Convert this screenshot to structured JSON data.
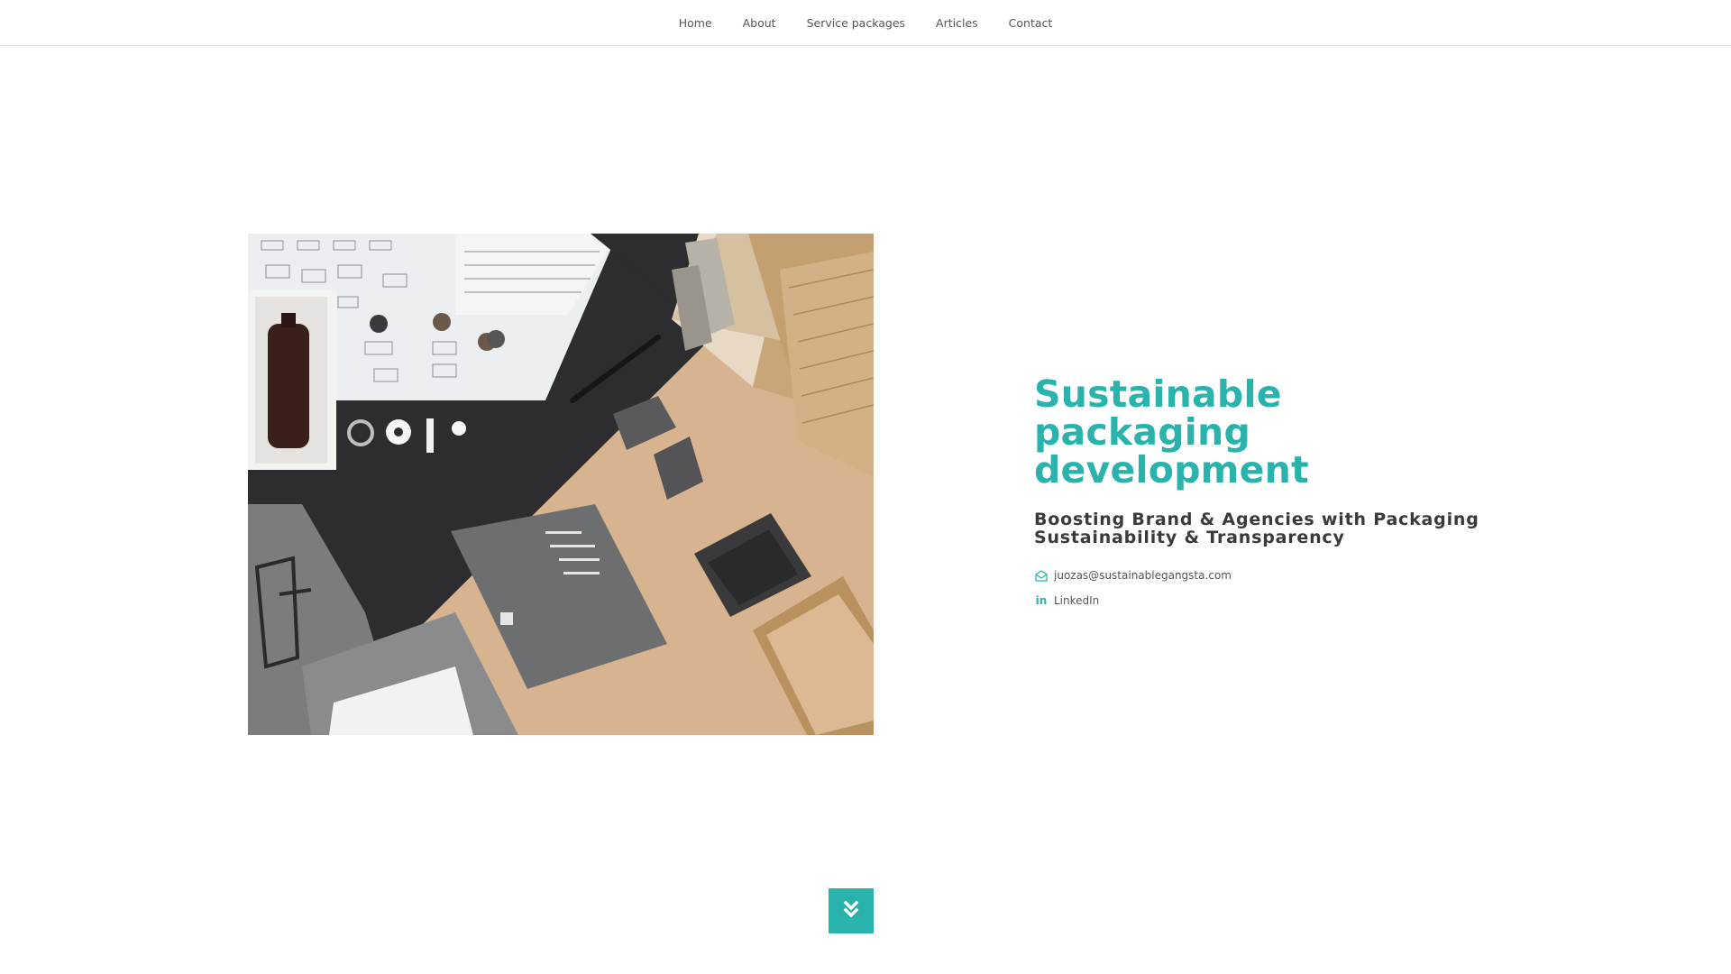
{
  "nav": {
    "items": [
      {
        "label": "Home"
      },
      {
        "label": "About"
      },
      {
        "label": "Service packages"
      },
      {
        "label": "Articles"
      },
      {
        "label": "Contact"
      }
    ]
  },
  "hero": {
    "title": "Sustainable packaging development",
    "subtitle": "Boosting Brand & Agencies with Packaging Sustainability & Transparency",
    "email": "juozas@sustainablegangsta.com",
    "linkedin_label": "LinkedIn",
    "linkedin_icon_text": "in",
    "image_icon": "packaging-flatlay-photo"
  },
  "scroll_button": {
    "icon": "double-chevron-down-icon"
  },
  "colors": {
    "accent": "#2ab3ad",
    "text_dark": "#3a3a3a",
    "nav_text": "#555555"
  }
}
